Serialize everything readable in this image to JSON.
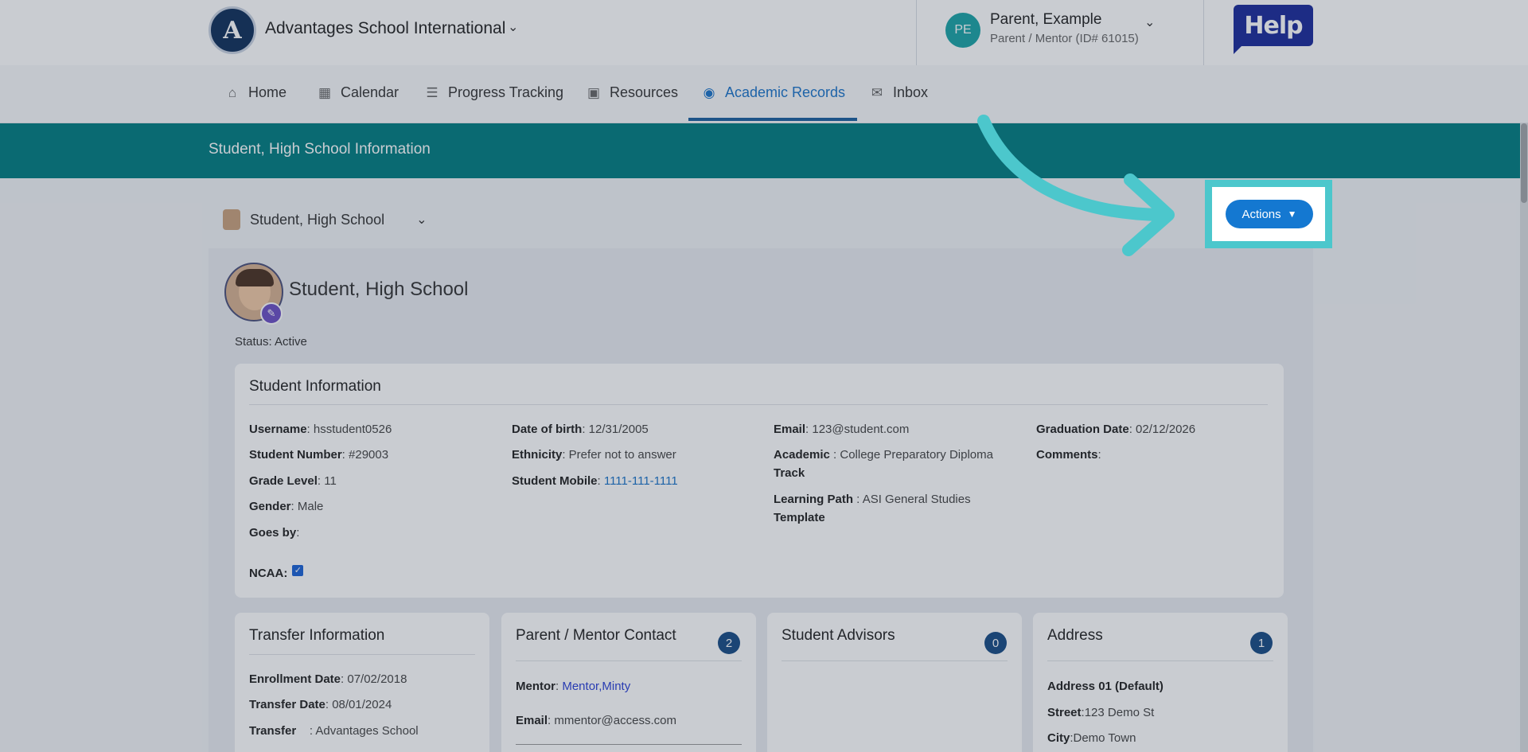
{
  "header": {
    "logo_text": "A",
    "school_name": "Advantages School International",
    "user_initials": "PE",
    "user_name": "Parent, Example",
    "user_role": "Parent / Mentor (ID# 61015)",
    "help_label": "Help"
  },
  "nav": [
    {
      "label": "Home",
      "icon": "home-icon"
    },
    {
      "label": "Calendar",
      "icon": "calendar-icon"
    },
    {
      "label": "Progress Tracking",
      "icon": "progress-icon"
    },
    {
      "label": "Resources",
      "icon": "inbox-tray-icon"
    },
    {
      "label": "Academic Records",
      "icon": "user-circle-icon"
    },
    {
      "label": "Inbox",
      "icon": "envelope-icon"
    }
  ],
  "banner_title": "Student, High School Information",
  "student_selector": "Student, High School",
  "actions_label": "Actions",
  "profile": {
    "name": "Student, High School",
    "status": "Status: Active"
  },
  "student_info": {
    "title": "Student Information",
    "col1": [
      {
        "label": "Username",
        "value": ": hsstudent0526"
      },
      {
        "label": "Student Number",
        "value": ": #29003"
      },
      {
        "label": "Grade Level",
        "value": ": 11"
      },
      {
        "label": "Gender",
        "value": ": Male"
      },
      {
        "label": "Goes by",
        "value": ":"
      }
    ],
    "ncaa_label": "NCAA:",
    "col2": [
      {
        "label": "Date of birth",
        "value": ": 12/31/2005"
      },
      {
        "label": "Ethnicity",
        "value": ": Prefer not to answer"
      },
      {
        "label": "Student Mobile",
        "value": ": ",
        "link": "1111-111-1111"
      }
    ],
    "col3": {
      "email_label": "Email",
      "email_value": ":  123@student.com",
      "academic_label1": "Academic",
      "academic_label2": "Track",
      "academic_value": " : College Preparatory Diploma",
      "path_label1": "Learning Path",
      "path_label2": "Template",
      "path_value": " : ASI General Studies"
    },
    "col4": [
      {
        "label": "Graduation Date",
        "value": ": 02/12/2026"
      },
      {
        "label": "Comments",
        "value": ":"
      }
    ]
  },
  "transfer": {
    "title": "Transfer Information",
    "enrollment_label": "Enrollment Date",
    "enrollment_value": ": 07/02/2018",
    "transfer_label": "Transfer Date",
    "transfer_value": ": 08/01/2024",
    "transfer_from_label": "Transfer",
    "transfer_from_value": ": Advantages School"
  },
  "parent_contact": {
    "title": "Parent / Mentor Contact",
    "count": "2",
    "mentor_label": "Mentor",
    "mentor_value": "Mentor,Minty",
    "email_label": "Email",
    "email_value": ": mmentor@access.com"
  },
  "advisors": {
    "title": "Student Advisors",
    "count": "0"
  },
  "address": {
    "title": "Address",
    "count": "1",
    "address_label": "Address 01 (Default)",
    "street_label": "Street",
    "street_value": ":123 Demo St",
    "city_label": "City",
    "city_value": ":Demo Town"
  },
  "colors": {
    "banner": "#007c80",
    "accent": "#1478d1",
    "highlight": "#4cc7cc"
  }
}
